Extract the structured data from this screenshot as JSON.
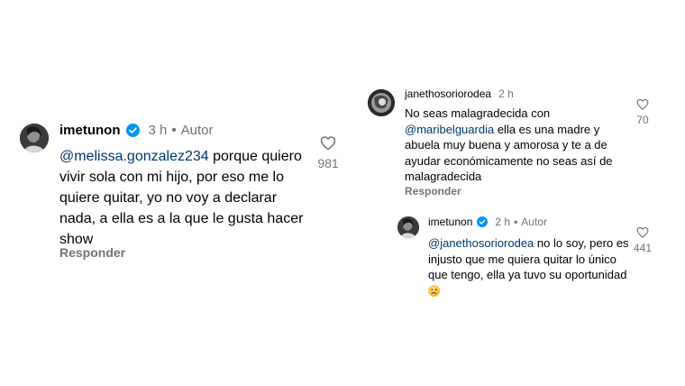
{
  "comments": [
    {
      "username": "imetunon",
      "verified": true,
      "time": "3 h",
      "tag": "Autor",
      "mention": "@melissa.gonzalez234",
      "text": " porque quiero vivir sola con mi hijo, por eso me lo quiere quitar, yo no voy a declarar nada, a ella es a la que le gusta hacer show",
      "reply_label": "Responder",
      "likes": "981"
    },
    {
      "username": "janethosoriorodea",
      "verified": false,
      "time": "2 h",
      "pre_text": "No seas malagradecida con ",
      "mention": "@maribelguardia",
      "text": " ella es una madre y abuela muy buena y amorosa y te a de ayudar económicamente no seas así de malagradecida",
      "reply_label": "Responder",
      "likes": "70"
    },
    {
      "username": "imetunon",
      "verified": true,
      "time": "2 h",
      "tag": "Autor",
      "mention": "@janethosoriorodea",
      "text": " no lo soy, pero es injusto que me quiera quitar lo único que tengo, ella ya tuvo su oportunidad ",
      "emoji": "worried-face-emoji",
      "likes": "441"
    }
  ],
  "icons": {
    "like": "heart-outline-icon",
    "verified": "verified-badge-icon"
  },
  "colors": {
    "mention": "#00376b",
    "meta": "#737373",
    "verified": "#0095f6"
  }
}
